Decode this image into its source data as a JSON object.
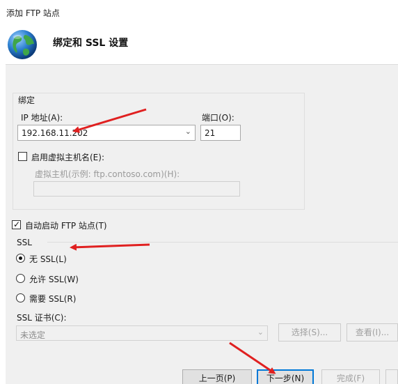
{
  "window": {
    "title": "添加 FTP 站点"
  },
  "header": {
    "title": "绑定和 SSL 设置",
    "icon": "globe-icon"
  },
  "binding": {
    "group_label": "绑定",
    "ip_label": "IP 地址(A):",
    "ip_value": "192.168.11.202",
    "port_label": "端口(O):",
    "port_value": "21",
    "virtual_host_checkbox": "启用虚拟主机名(E):",
    "virtual_host_checked": false,
    "virtual_host_label": "虚拟主机(示例: ftp.contoso.com)(H):",
    "virtual_host_value": ""
  },
  "auto_start": {
    "label": "自动启动 FTP 站点(T)",
    "checked": true
  },
  "ssl": {
    "section_label": "SSL",
    "options": [
      {
        "label": "无 SSL(L)",
        "selected": true
      },
      {
        "label": "允许 SSL(W)",
        "selected": false
      },
      {
        "label": "需要 SSL(R)",
        "selected": false
      }
    ],
    "cert_label": "SSL 证书(C):",
    "cert_value": "未选定",
    "select_button": "选择(S)...",
    "view_button": "查看(I)..."
  },
  "footer": {
    "prev_button": "上一页(P)",
    "next_button": "下一步(N)",
    "finish_button": "完成(F)"
  },
  "colors": {
    "annotation_arrow": "#e02020",
    "focus_border": "#0078d7"
  }
}
